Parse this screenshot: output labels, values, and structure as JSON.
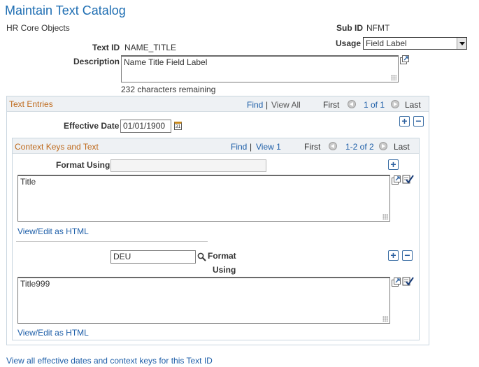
{
  "page": {
    "title": "Maintain Text Catalog"
  },
  "header": {
    "object_name": "HR Core Objects",
    "sub_id_label": "Sub ID",
    "sub_id_value": "NFMT",
    "text_id_label": "Text ID",
    "text_id_value": "NAME_TITLE",
    "usage_label": "Usage",
    "usage_value": "Field Label",
    "description_label": "Description",
    "description_value": "Name Title Field Label",
    "chars_remaining": "232 characters remaining"
  },
  "text_entries": {
    "title": "Text Entries",
    "find": "Find",
    "sep": "|",
    "view_all": "View All",
    "first": "First",
    "count": "1 of 1",
    "last": "Last",
    "effective_date_label": "Effective Date",
    "effective_date_value": "01/01/1900",
    "calendar_glyph": "31"
  },
  "context_keys": {
    "title": "Context Keys and Text",
    "find": "Find",
    "sep": "|",
    "view_1": "View 1",
    "first": "First",
    "count": "1-2 of 2",
    "last": "Last",
    "rows": [
      {
        "format_label": "Format Using",
        "format_value": "",
        "text": "Title",
        "html_link": "View/Edit as HTML"
      },
      {
        "format_label_line1": "Format",
        "format_label_line2": "Using",
        "format_value": "DEU",
        "text": "Title999",
        "html_link": "View/Edit as HTML"
      }
    ]
  },
  "footer": {
    "link": "View all effective dates and context keys for this Text ID"
  },
  "icons": {
    "add": "+",
    "delete": "−"
  },
  "colors": {
    "title": "#1d6db2",
    "section_title": "#bf6a1c",
    "link": "#1d5ea8",
    "header_bg": "#eef1f4"
  }
}
